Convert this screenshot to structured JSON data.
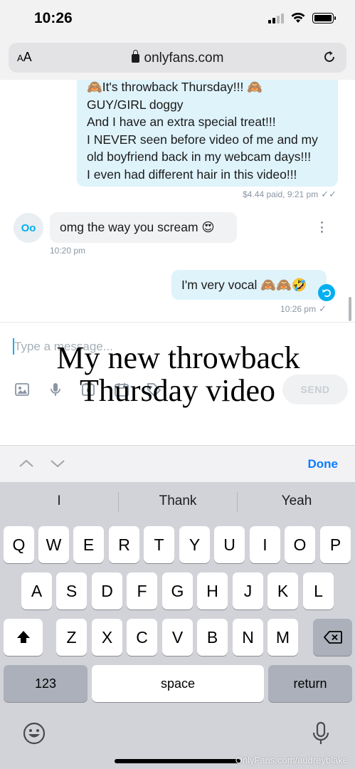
{
  "status_bar": {
    "time": "10:26"
  },
  "browser": {
    "aa_label_small": "A",
    "aa_label": "A",
    "url": "onlyfans.com"
  },
  "chat": {
    "messages": [
      {
        "direction": "outgoing",
        "lines": [
          "🙈It's throwback Thursday!!! 🙈",
          "GUY/GIRL doggy",
          "And I have an extra special treat!!!",
          "I NEVER seen before video of me and my",
          "old boyfriend back in my webcam days!!!",
          "I even had different hair in this video!!!"
        ],
        "meta": "$4.44 paid, 9:21 pm",
        "check": "✓✓"
      },
      {
        "direction": "incoming",
        "avatar": "Oo",
        "text": "omg the way you scream 😍",
        "meta": "10:20 pm"
      },
      {
        "direction": "outgoing",
        "text": "I'm very vocal 🙈🙈🤣",
        "meta": "10:26 pm",
        "check": "✓"
      }
    ]
  },
  "composer": {
    "placeholder": "Type a message...",
    "send_label": "SEND",
    "tools": [
      "image-icon",
      "microphone-icon",
      "media-vault-icon",
      "calendar-icon",
      "price-tag-icon"
    ]
  },
  "overlay_caption": {
    "line1": "My new throwback",
    "line2": "Thursday video"
  },
  "keyboard": {
    "done_label": "Done",
    "suggestions": [
      "I",
      "Thank",
      "Yeah"
    ],
    "row1": [
      "Q",
      "W",
      "E",
      "R",
      "T",
      "Y",
      "U",
      "I",
      "O",
      "P"
    ],
    "row2": [
      "A",
      "S",
      "D",
      "F",
      "G",
      "H",
      "J",
      "K",
      "L"
    ],
    "row3": [
      "Z",
      "X",
      "C",
      "V",
      "B",
      "N",
      "M"
    ],
    "numbers_label": "123",
    "space_label": "space",
    "return_label": "return"
  },
  "watermark": "OnlyFans.com/audreyblake",
  "colors": {
    "accent": "#00aff0",
    "bubble_out": "#dff3fb",
    "bubble_in": "#f0f2f4",
    "keyboard_bg": "#d1d3d9",
    "ios_blue": "#0a7cff"
  }
}
